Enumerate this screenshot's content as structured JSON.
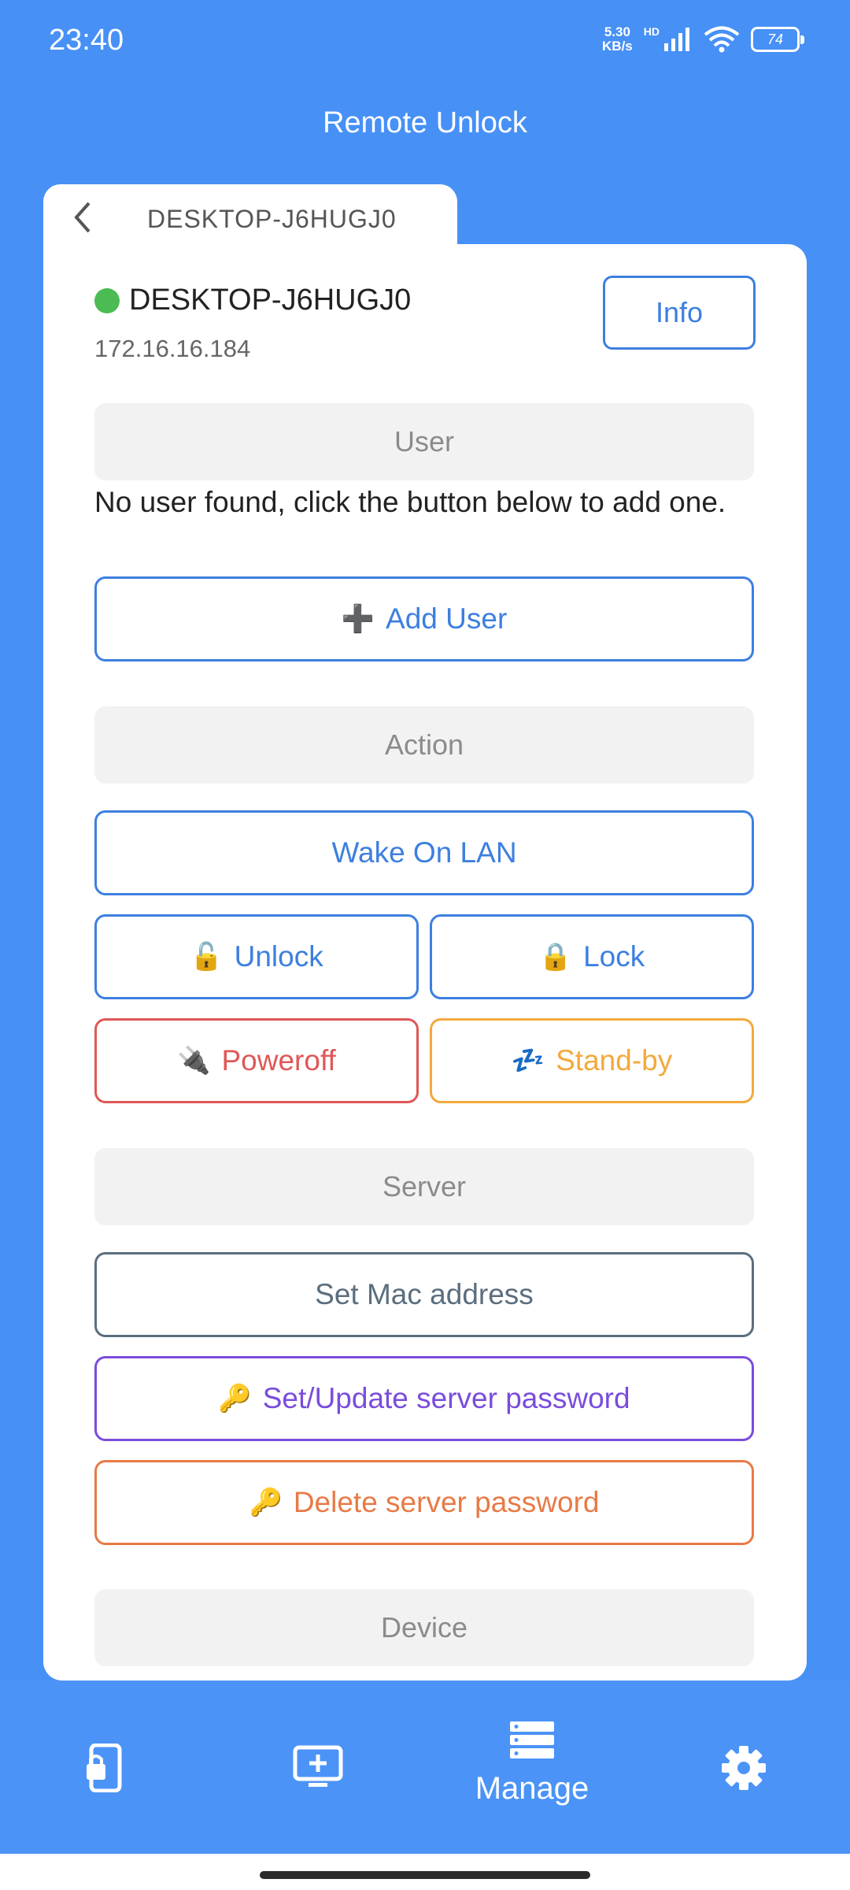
{
  "status": {
    "time": "23:40",
    "net_speed_value": "5.30",
    "net_speed_unit": "KB/s",
    "hd": "HD",
    "battery": "74"
  },
  "app": {
    "title": "Remote Unlock"
  },
  "tab": {
    "label": "DESKTOP-J6HUGJ0"
  },
  "device": {
    "name": "DESKTOP-J6HUGJ0",
    "ip": "172.16.16.184",
    "status_color": "#4cbb54",
    "info_label": "Info"
  },
  "sections": {
    "user": "User",
    "action": "Action",
    "server": "Server",
    "device": "Device"
  },
  "user": {
    "empty_message": "No user found, click the button below to add one.",
    "add_user_icon": "➕",
    "add_user_label": "Add User"
  },
  "actions": {
    "wake_on_lan": "Wake On LAN",
    "unlock_icon": "🔓",
    "unlock": "Unlock",
    "lock_icon": "🔒",
    "lock": "Lock",
    "poweroff_icon": "🔌",
    "poweroff": "Poweroff",
    "standby_icon": "💤",
    "standby": "Stand-by"
  },
  "server": {
    "set_mac": "Set Mac address",
    "key_icon": "🔑",
    "set_password": "Set/Update server password",
    "delete_password": "Delete server password"
  },
  "colors": {
    "primary": "#3d7fe0",
    "danger": "#e05757",
    "warning": "#f3a93c",
    "slate": "#5b6e7e",
    "purple": "#7a4cdc",
    "orange": "#e87a45",
    "header_bg": "#4790f6"
  },
  "nav": {
    "items": [
      {
        "icon": "phone-lock-icon",
        "label": ""
      },
      {
        "icon": "monitor-add-icon",
        "label": ""
      },
      {
        "icon": "server-list-icon",
        "label": "Manage"
      },
      {
        "icon": "gear-icon",
        "label": ""
      }
    ]
  }
}
